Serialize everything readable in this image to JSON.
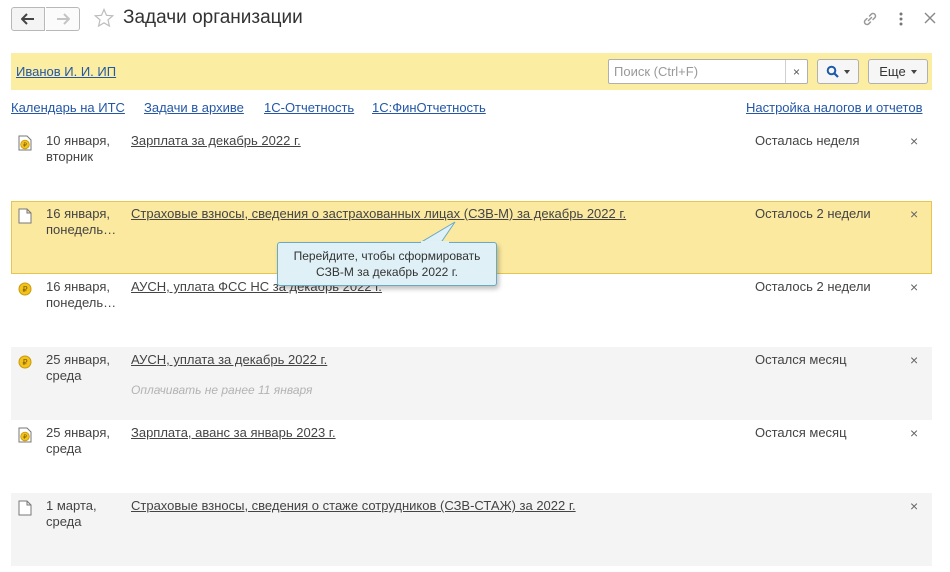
{
  "window": {
    "title": "Задачи организации",
    "icons": [
      "arrow-left-icon",
      "arrow-right-icon",
      "star-icon",
      "link-icon",
      "more-vertical-icon",
      "close-icon"
    ]
  },
  "orgbar": {
    "organization": "Иванов И. И. ИП",
    "search_placeholder": "Поиск (Ctrl+F)",
    "search_clear": "×",
    "more_label": "Еще"
  },
  "links": {
    "calendar": "Календарь на ИТС",
    "archive": "Задачи в архиве",
    "reporting": "1С-Отчетность",
    "finreporting": "1С:ФинОтчетность",
    "tax_settings": "Настройка налогов и отчетов"
  },
  "tasks": [
    {
      "date": "10 января,",
      "weekday": "вторник",
      "title": "Зарплата за декабрь 2022 г.",
      "note": "",
      "remaining": "Осталась неделя",
      "icon": "payment-document-icon",
      "close": "×"
    },
    {
      "date": "16 января,",
      "weekday": "понедель…",
      "title": "Страховые взносы, сведения о застрахованных лицах (СЗВ-М) за декабрь 2022 г.",
      "note": "",
      "remaining": "Осталось 2 недели",
      "icon": "document-icon",
      "close": "×"
    },
    {
      "date": "16 января,",
      "weekday": "понедель…",
      "title": "АУСН, уплата ФСС НС за декабрь 2022 г.",
      "note": "",
      "remaining": "Осталось 2 недели",
      "icon": "ruble-coin-icon",
      "close": "×"
    },
    {
      "date": "25 января,",
      "weekday": "среда",
      "title": "АУСН, уплата за декабрь 2022 г.",
      "note": "Оплачивать не ранее 11 января",
      "remaining": "Остался месяц",
      "icon": "ruble-coin-icon",
      "close": "×"
    },
    {
      "date": "25 января,",
      "weekday": "среда",
      "title": "Зарплата, аванс за январь 2023 г.",
      "note": "",
      "remaining": "Остался месяц",
      "icon": "payment-document-icon",
      "close": "×"
    },
    {
      "date": "1 марта,",
      "weekday": "среда",
      "title": "Страховые взносы, сведения о стаже сотрудников (СЗВ-СТАЖ) за 2022 г.",
      "note": "",
      "remaining": "",
      "icon": "document-icon",
      "close": "×"
    }
  ],
  "tooltip": {
    "line1": "Перейдите, чтобы сформировать",
    "line2": "СЗВ-М за декабрь 2022 г."
  },
  "colors": {
    "accent_yellow": "#fbeda1",
    "link_blue": "#2457a6",
    "coin_gold": "#f3c21b",
    "tooltip_bg": "#dff1f7"
  }
}
